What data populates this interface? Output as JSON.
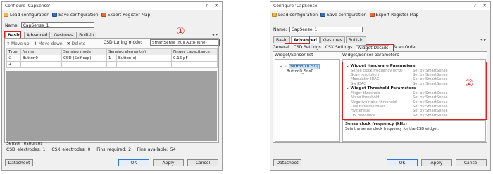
{
  "left": {
    "title": "Configure 'CapSense'",
    "help_glyph": "?",
    "close_glyph": "✕",
    "toolbar": {
      "load": "Load configuration",
      "save": "Save configuration",
      "export": "Export Register Map"
    },
    "name_label": "Name:",
    "name_value": "CapSense_1",
    "tabs": [
      "Basic",
      "Advanced",
      "Gestures",
      "Built-in"
    ],
    "tab_arrows": "◂ ▸",
    "annotation": "①",
    "subbar": {
      "move_up": "Move up",
      "move_down": "Move down",
      "delete": "Delete",
      "tuning_label": "CSD tuning mode:",
      "tuning_value": "SmartSense (Full Auto-Tune)"
    },
    "table": {
      "headers": [
        "Type",
        "Name",
        "Sensing mode",
        "Sensing element(s)",
        "Finger capacitance"
      ],
      "row": [
        "⊙",
        "Button0",
        "CSD (Self-cap)",
        "1",
        "Button(s)",
        "0.16 pF"
      ],
      "add_glyph": "+"
    },
    "resources": {
      "label": "Sensor resources",
      "csd_electrodes": "CSD electrodes: 1",
      "csx_electrodes": "CSX electrodes: 0",
      "pins_required": "Pins required: 2",
      "pins_available": "Pins available: 54"
    },
    "buttons": {
      "datasheet": "Datasheet",
      "ok": "OK",
      "apply": "Apply",
      "cancel": "Cancel"
    }
  },
  "right": {
    "title": "Configure 'CapSense'",
    "help_glyph": "?",
    "close_glyph": "✕",
    "toolbar": {
      "load": "Load configuration",
      "save": "Save configuration",
      "export": "Export Register Map"
    },
    "name_label": "Name:",
    "name_value": "CapSense_1",
    "tabs": [
      "Basic",
      "Advanced",
      "Gestures",
      "Built-in"
    ],
    "tab_arrows": "◂ ▸",
    "subtabs": [
      "General",
      "CSD Settings",
      "CSX Settings",
      "Widget Details",
      "Scan Order"
    ],
    "annotation": "②",
    "list_header": "Widget/Sensor list",
    "params_header": "Widget/Sensor parameters",
    "tree": {
      "widget": "Button0 (CSD)",
      "sensor": "Button0_Sns0"
    },
    "hw_header": "Widget Hardware Parameters",
    "hw_params": [
      {
        "name": "Sense clock frequency (kHz)",
        "value": "Set by SmartSense"
      },
      {
        "name": "Scan resolution",
        "value": "Set by SmartSense"
      },
      {
        "name": "Modulator IDAC",
        "value": "Set by SmartSense"
      },
      {
        "name": "Sw IDAC",
        "value": "Set by SmartSense"
      }
    ],
    "th_header": "Widget Threshold Parameters",
    "th_params": [
      {
        "name": "Finger threshold",
        "value": "Set by SmartSense"
      },
      {
        "name": "Noise threshold",
        "value": "Set by SmartSense"
      },
      {
        "name": "Negative noise threshold",
        "value": "Set by SmartSense"
      },
      {
        "name": "Low baseline reset",
        "value": "Set by SmartSense"
      },
      {
        "name": "Hysteresis",
        "value": "Set by SmartSense"
      },
      {
        "name": "ON debounce",
        "value": "Set by SmartSense"
      }
    ],
    "desc_title": "Sense clock frequency (kHz)",
    "desc_body": "Sets the sense clock frequency for the CSD widget.",
    "buttons": {
      "datasheet": "Datasheet",
      "ok": "OK",
      "apply": "Apply",
      "cancel": "Cancel"
    }
  },
  "colors": {
    "annotation_red": "#e02020",
    "selection_blue": "#cce4f7",
    "grid_gray": "#a0a0a0"
  }
}
